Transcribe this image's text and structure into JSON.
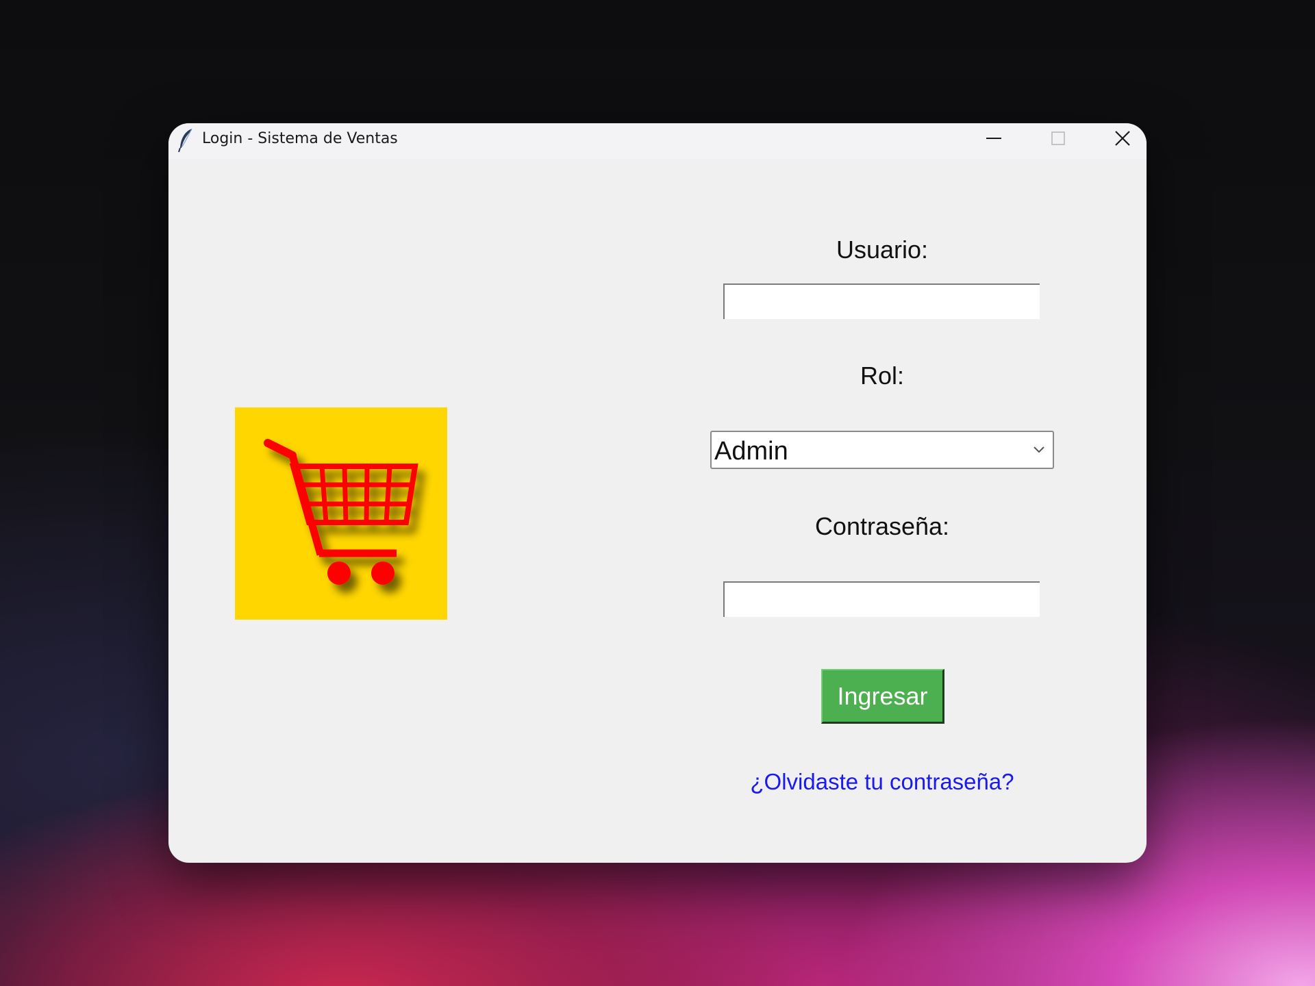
{
  "window": {
    "title": "Login - Sistema de Ventas",
    "app_icon": "feather-icon",
    "controls": {
      "minimize": "minimize-icon",
      "maximize": "maximize-icon",
      "close": "close-icon"
    }
  },
  "logo": {
    "icon": "shopping-cart-icon",
    "background_color": "#ffd600",
    "cart_color": "#ff0000"
  },
  "form": {
    "usuario_label": "Usuario:",
    "usuario_value": "",
    "rol_label": "Rol:",
    "rol_selected": "Admin",
    "contrasena_label": "Contraseña:",
    "contrasena_value": "",
    "submit_label": "Ingresar",
    "forgot_link": "¿Olvidaste tu contraseña?"
  },
  "colors": {
    "submit_button": "#4caf50",
    "link": "#1a1af0",
    "window_background": "#f0f0f0"
  }
}
